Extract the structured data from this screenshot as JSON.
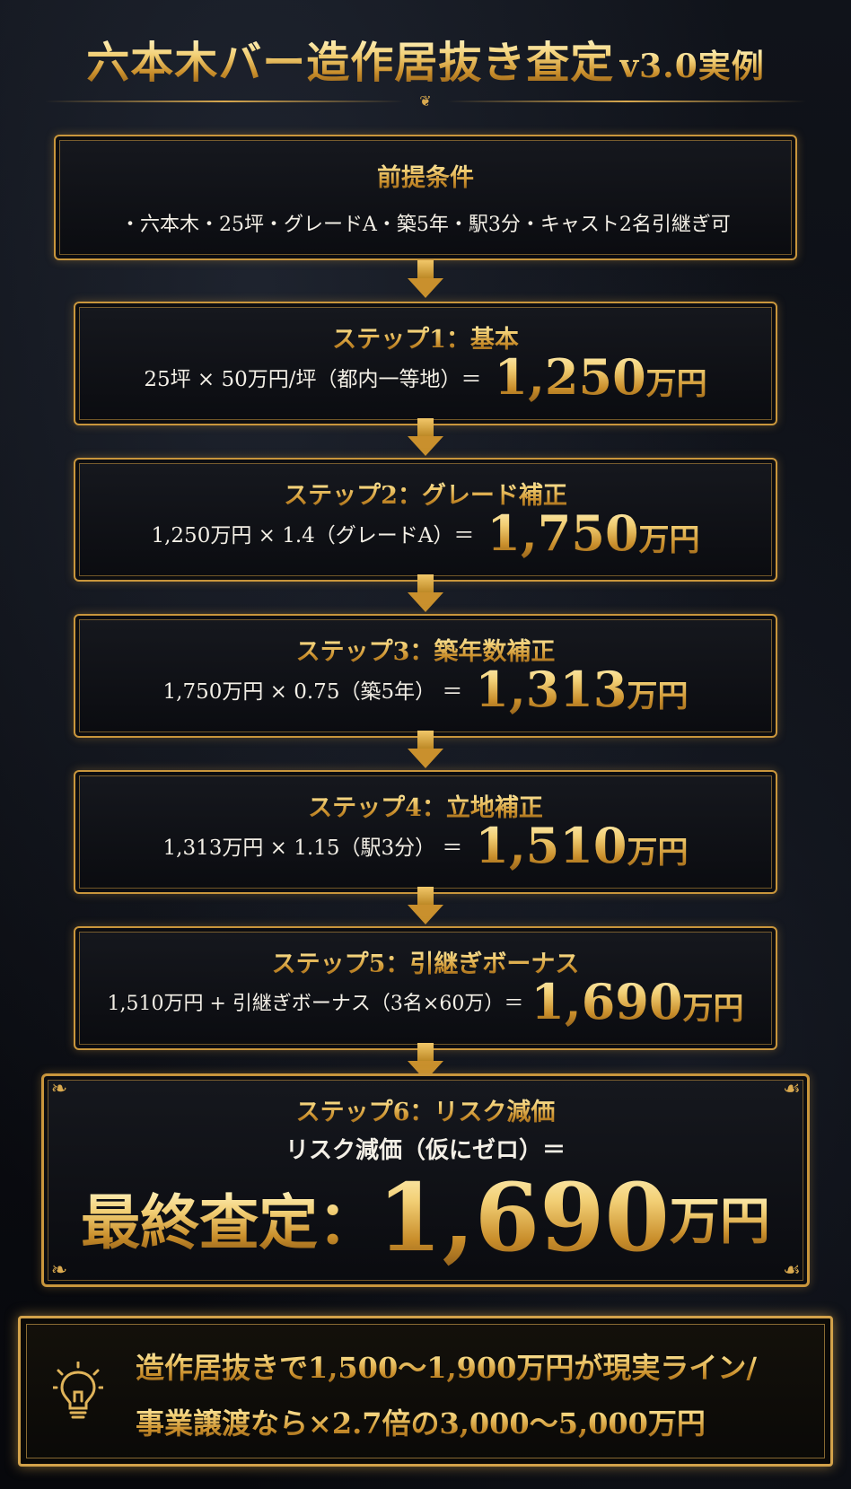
{
  "header": {
    "title_main": "六本木バー造作居抜き査定",
    "title_suffix": "v3.0実例"
  },
  "premise": {
    "heading": "前提条件",
    "detail": "・六本木・25坪・グレードA・築5年・駅3分・キャスト2名引継ぎ可"
  },
  "steps": [
    {
      "heading": "ステップ1：基本",
      "formula": "25坪 × 50万円/坪（都内一等地）＝",
      "result": "1,250",
      "unit": "万円"
    },
    {
      "heading": "ステップ2：グレード補正",
      "formula": "1,250万円 × 1.4（グレードA）＝",
      "result": "1,750",
      "unit": "万円"
    },
    {
      "heading": "ステップ3：築年数補正",
      "formula": "1,750万円 × 0.75（築5年） ＝",
      "result": "1,313",
      "unit": "万円"
    },
    {
      "heading": "ステップ4：立地補正",
      "formula": "1,313万円 × 1.15（駅3分） ＝",
      "result": "1,510",
      "unit": "万円"
    },
    {
      "heading": "ステップ5：引継ぎボーナス",
      "formula": "1,510万円 + 引継ぎボーナス（3名×60万）＝",
      "result": "1,690",
      "unit": "万円"
    }
  ],
  "final": {
    "heading": "ステップ6：リスク減価",
    "formula": "リスク減価（仮にゼロ）＝",
    "label": "最終査定：",
    "result": "1,690",
    "unit": "万円"
  },
  "note": {
    "line1": "造作居抜きで1,500〜1,900万円が現実ライン/",
    "line2": "事業譲渡なら×2.7倍の3,000〜5,000万円",
    "icon": "lightbulb-icon"
  },
  "colors": {
    "gold": "#c9963c",
    "background": "#0b0d12"
  }
}
